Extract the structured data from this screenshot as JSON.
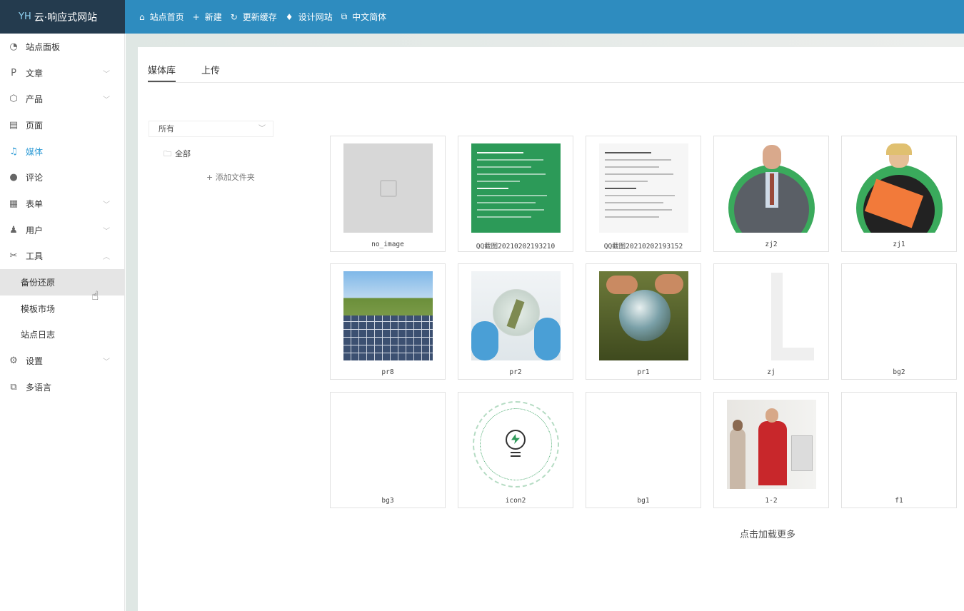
{
  "app": {
    "logo_mark": "YH",
    "title": "云·响应式网站"
  },
  "topnav": [
    {
      "icon": "⌂",
      "icon_name": "home-icon",
      "label": "站点首页"
    },
    {
      "icon": "+",
      "icon_name": "plus-icon",
      "label": "新建"
    },
    {
      "icon": "↻",
      "icon_name": "refresh-icon",
      "label": "更新缓存"
    },
    {
      "icon": "♦",
      "icon_name": "shirt-icon",
      "label": "设计网站"
    },
    {
      "icon": "⧉",
      "icon_name": "language-icon",
      "label": "中文简体"
    }
  ],
  "sidebar": {
    "items": [
      {
        "icon": "◔",
        "icon_name": "dashboard-icon",
        "label": "站点面板",
        "chevron": ""
      },
      {
        "icon": "P",
        "icon_name": "article-icon",
        "label": "文章",
        "chevron": "﹀"
      },
      {
        "icon": "⬡",
        "icon_name": "product-icon",
        "label": "产品",
        "chevron": "﹀"
      },
      {
        "icon": "▤",
        "icon_name": "page-icon",
        "label": "页面",
        "chevron": ""
      },
      {
        "icon": "♫",
        "icon_name": "media-icon",
        "label": "媒体",
        "chevron": ""
      },
      {
        "icon": "●",
        "icon_name": "comment-icon",
        "label": "评论",
        "chevron": ""
      },
      {
        "icon": "▦",
        "icon_name": "form-icon",
        "label": "表单",
        "chevron": "﹀"
      },
      {
        "icon": "♟",
        "icon_name": "user-icon",
        "label": "用户",
        "chevron": "﹀"
      },
      {
        "icon": "✂",
        "icon_name": "tools-icon",
        "label": "工具",
        "chevron": "︿"
      }
    ],
    "subitems": [
      {
        "label": "备份还原"
      },
      {
        "label": "模板市场"
      },
      {
        "label": "站点日志"
      }
    ],
    "bottom_items": [
      {
        "icon": "⚙",
        "icon_name": "settings-icon",
        "label": "设置",
        "chevron": "﹀"
      },
      {
        "icon": "⧉",
        "icon_name": "multilang-icon",
        "label": "多语言",
        "chevron": ""
      }
    ],
    "active": "媒体",
    "selected_sub": "备份还原"
  },
  "tabs": [
    {
      "label": "媒体库",
      "active": true
    },
    {
      "label": "上传",
      "active": false
    }
  ],
  "folders": {
    "select_value": "所有",
    "all_label": "全部",
    "add_label": "+ 添加文件夹"
  },
  "media": [
    {
      "name": "no_image",
      "kind": "placeholder"
    },
    {
      "name": "QQ截图20210202193210",
      "kind": "doc-green"
    },
    {
      "name": "QQ截图20210202193152",
      "kind": "doc-white"
    },
    {
      "name": "zj2",
      "kind": "man"
    },
    {
      "name": "zj1",
      "kind": "woman"
    },
    {
      "name": "pr8",
      "kind": "solar"
    },
    {
      "name": "pr2",
      "kind": "gloves"
    },
    {
      "name": "pr1",
      "kind": "globe"
    },
    {
      "name": "zj",
      "kind": "letter"
    },
    {
      "name": "bg2",
      "kind": "blank"
    },
    {
      "name": "bg3",
      "kind": "blank"
    },
    {
      "name": "icon2",
      "kind": "bulb"
    },
    {
      "name": "bg1",
      "kind": "blank"
    },
    {
      "name": "1-2",
      "kind": "workers"
    },
    {
      "name": "f1",
      "kind": "blank"
    }
  ],
  "load_more": "点击加载更多",
  "colors": {
    "topbar": "#2e8cbf",
    "logo_bg": "#243b4e",
    "active": "#2e9bd6",
    "green": "#2c9a58"
  }
}
